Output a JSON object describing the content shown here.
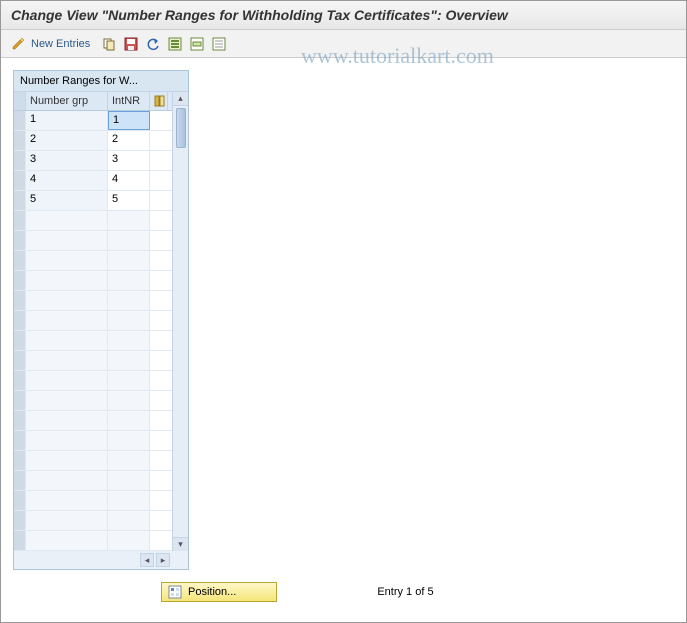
{
  "title": "Change View \"Number Ranges for Withholding Tax Certificates\": Overview",
  "toolbar": {
    "new_entries_label": "New Entries"
  },
  "watermark": "www.tutorialkart.com",
  "panel": {
    "header": "Number Ranges for W...",
    "columns": {
      "number_grp": "Number grp",
      "int_nr": "IntNR"
    },
    "rows": [
      {
        "number_grp": "1",
        "int_nr": "1",
        "selected_intnr": true
      },
      {
        "number_grp": "2",
        "int_nr": "2",
        "selected_intnr": false
      },
      {
        "number_grp": "3",
        "int_nr": "3",
        "selected_intnr": false
      },
      {
        "number_grp": "4",
        "int_nr": "4",
        "selected_intnr": false
      },
      {
        "number_grp": "5",
        "int_nr": "5",
        "selected_intnr": false
      }
    ],
    "empty_rows": 17
  },
  "footer": {
    "position_label": "Position...",
    "entry_text": "Entry 1 of 5"
  }
}
